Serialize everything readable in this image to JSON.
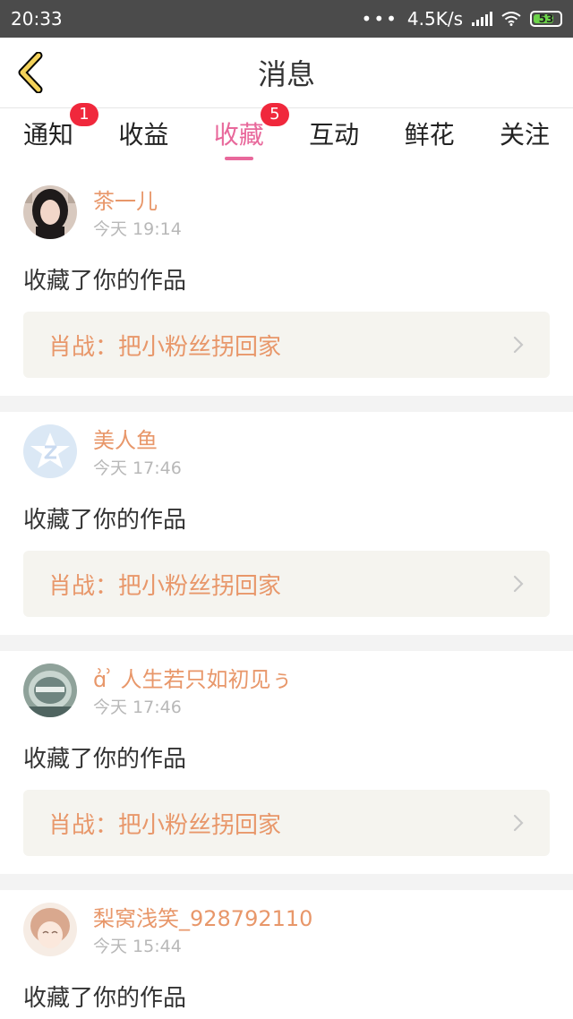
{
  "status": {
    "time": "20:33",
    "dots": "•••",
    "speed": "4.5K/s",
    "battery": "53"
  },
  "header": {
    "title": "消息"
  },
  "tabs": [
    {
      "label": "通知",
      "badge": "1"
    },
    {
      "label": "收益",
      "badge": ""
    },
    {
      "label": "收藏",
      "badge": "5"
    },
    {
      "label": "互动",
      "badge": ""
    },
    {
      "label": "鲜花",
      "badge": ""
    },
    {
      "label": "关注",
      "badge": ""
    }
  ],
  "active_tab": "收藏",
  "colors": {
    "accent": "#e8689b",
    "name": "#e8976a",
    "badge": "#f0283c"
  },
  "items": [
    {
      "name": "茶一儿",
      "time": "今天 19:14",
      "action": "收藏了你的作品",
      "work": "肖战：把小粉丝拐回家"
    },
    {
      "name": "美人鱼",
      "time": "今天 17:46",
      "action": "收藏了你的作品",
      "work": "肖战：把小粉丝拐回家"
    },
    {
      "name": "ɑ͗ ͗ 人生若只如初见ぅ",
      "time": "今天 17:46",
      "action": "收藏了你的作品",
      "work": "肖战：把小粉丝拐回家"
    },
    {
      "name": "梨窝浅笑_928792110",
      "time": "今天 15:44",
      "action": "收藏了你的作品",
      "work": ""
    }
  ]
}
